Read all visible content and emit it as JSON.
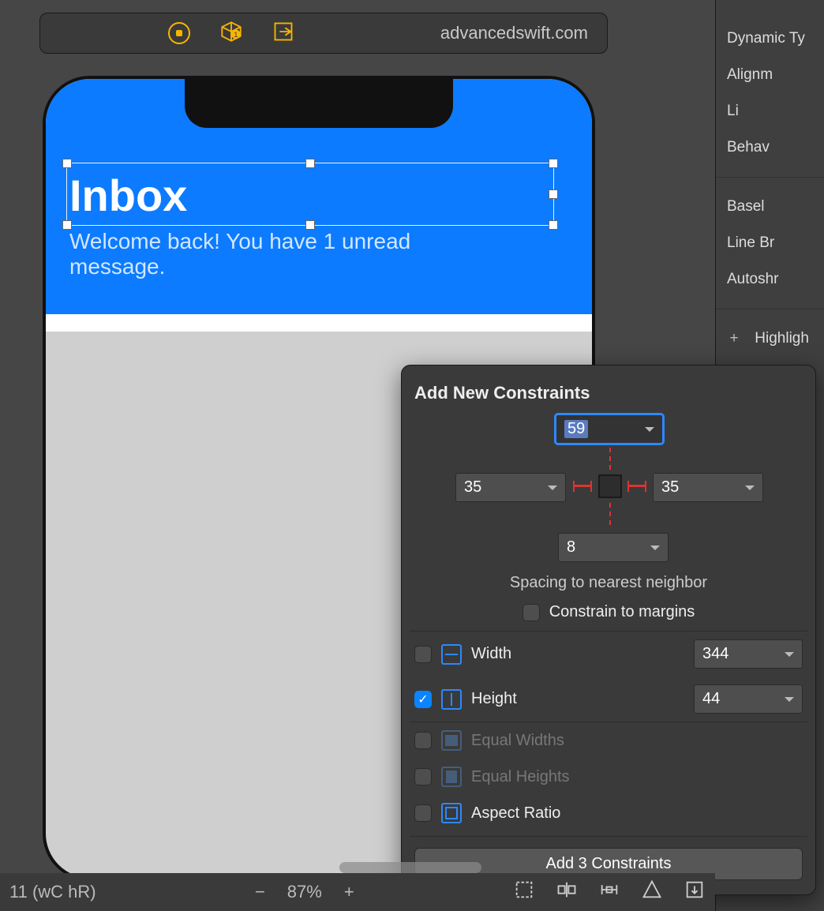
{
  "toolbar": {
    "domain": "advancedswift.com"
  },
  "phone": {
    "title": "Inbox",
    "subtitle": "Welcome back! You have 1 unread message."
  },
  "inspector": {
    "rows": [
      "Dynamic Ty",
      "Alignm",
      "Li",
      "Behav",
      "Basel",
      "Line Br",
      "Autoshr"
    ],
    "highlight": "Highligh"
  },
  "popover": {
    "title": "Add New Constraints",
    "spacing": {
      "top": "59",
      "left": "35",
      "right": "35",
      "bottom": "8"
    },
    "spacing_caption": "Spacing to nearest neighbor",
    "constrain_margins_label": "Constrain to margins",
    "constrain_margins_checked": false,
    "width": {
      "label": "Width",
      "value": "344",
      "checked": false
    },
    "height": {
      "label": "Height",
      "value": "44",
      "checked": true
    },
    "equal_widths_label": "Equal Widths",
    "equal_heights_label": "Equal Heights",
    "aspect_ratio_label": "Aspect Ratio",
    "add_button": "Add 3 Constraints"
  },
  "bottombar": {
    "status": "11 (wC hR)",
    "zoom_out": "−",
    "zoom": "87%",
    "zoom_in": "+"
  }
}
